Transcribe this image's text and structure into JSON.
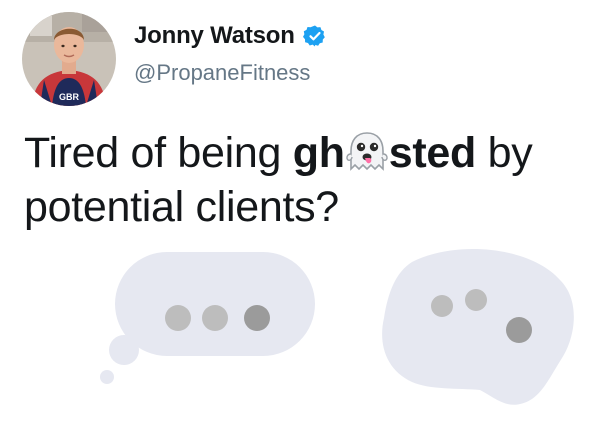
{
  "tweet": {
    "author": {
      "display_name": "Jonny Watson",
      "handle": "@PropaneFitness",
      "verified": true,
      "avatar_jersey_text": "GBR"
    },
    "text": {
      "part1": "Tired of being ",
      "bold_start": "gh",
      "emoji": "ghost-emoji",
      "bold_end": "sted",
      "part2": " by",
      "line2": "potential clients?"
    },
    "image": {
      "description_elements": [
        "typing-bubble",
        "wobbly-typing-bubble"
      ],
      "bubble_color": "#e6e8f1",
      "dot_colors": [
        "#bdbdbd",
        "#bdbdbd",
        "#9b9b9b"
      ]
    },
    "colors": {
      "verified_blue": "#1da1f2",
      "handle_gray": "#657786",
      "text_black": "#14171a"
    }
  }
}
